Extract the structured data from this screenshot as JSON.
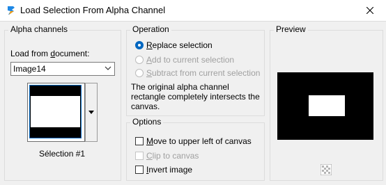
{
  "window": {
    "title": "Load Selection From Alpha Channel",
    "close_icon": "close-icon",
    "app_icon": "app-icon"
  },
  "alpha_channels": {
    "title": "Alpha channels",
    "load_from_label": "Load from document:",
    "document_value": "Image14",
    "selection_name": "Sélection #1"
  },
  "operation": {
    "title": "Operation",
    "options": [
      {
        "label": "Replace selection",
        "checked": true,
        "enabled": true
      },
      {
        "label": "Add to current selection",
        "checked": false,
        "enabled": false
      },
      {
        "label": "Subtract from current selection",
        "checked": false,
        "enabled": false
      }
    ],
    "info_text": "The original alpha channel rectangle completely intersects the canvas."
  },
  "options": {
    "title": "Options",
    "items": [
      {
        "label": "Move to upper left of canvas",
        "checked": false,
        "enabled": true
      },
      {
        "label": "Clip to canvas",
        "checked": false,
        "enabled": false
      },
      {
        "label": "Invert image",
        "checked": false,
        "enabled": true
      }
    ]
  },
  "preview": {
    "title": "Preview",
    "transparency_icon": "checkerboard-icon"
  },
  "colors": {
    "accent": "#0067c0",
    "disabled": "#a0a0a0"
  }
}
